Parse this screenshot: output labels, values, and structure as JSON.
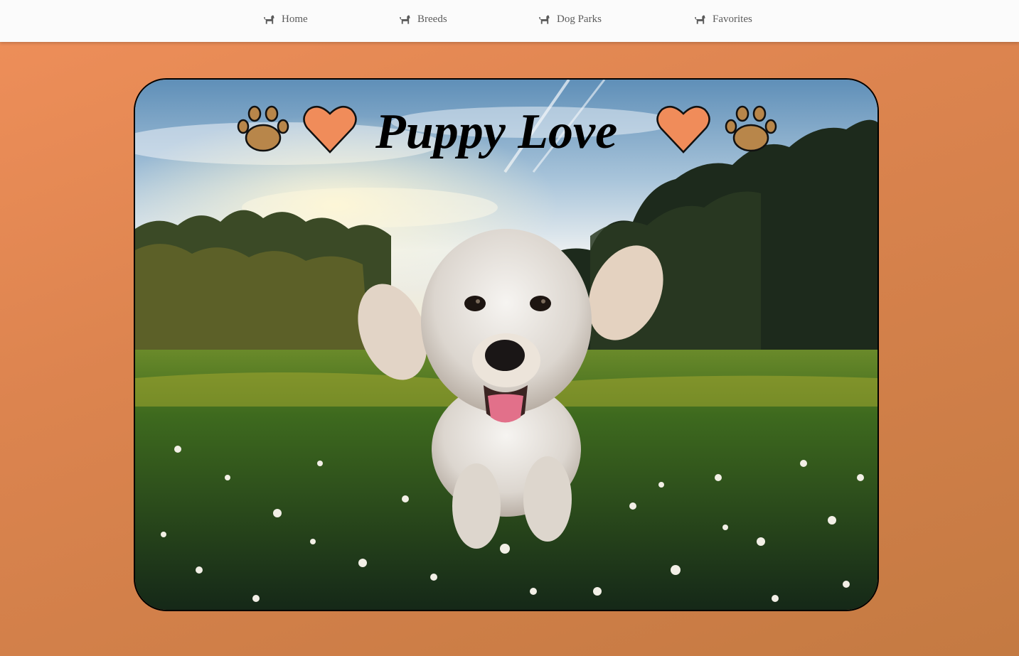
{
  "nav": {
    "items": [
      {
        "label": "Home",
        "icon": "dog-icon"
      },
      {
        "label": "Breeds",
        "icon": "dog-icon"
      },
      {
        "label": "Dog Parks",
        "icon": "dog-icon"
      },
      {
        "label": "Favorites",
        "icon": "dog-icon"
      }
    ]
  },
  "hero": {
    "title": "Puppy Love",
    "icons": [
      "paw-icon",
      "heart-icon",
      "heart-icon",
      "paw-icon"
    ],
    "image": "photo-running-white-dog-in-clover-field"
  },
  "colors": {
    "background_start": "#ef8f5a",
    "background_end": "#c47a42",
    "heart_fill": "#f08c5a",
    "paw_fill": "#b8864a",
    "nav_bg": "#fbfbfb",
    "nav_text": "#5b5b5b"
  }
}
